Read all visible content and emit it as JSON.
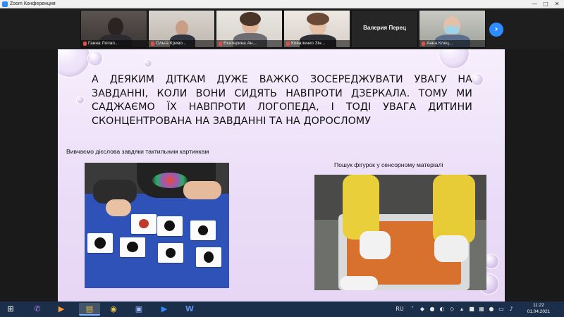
{
  "window": {
    "title": "Zoom Конференция",
    "minimize_glyph": "—",
    "maximize_glyph": "□",
    "close_glyph": "✕"
  },
  "participants": [
    {
      "name": "Ганна Лопап..."
    },
    {
      "name": "Ольга Криво..."
    },
    {
      "name": "Екатерина Ан..."
    },
    {
      "name": "Коваленко Зін..."
    },
    {
      "name": "Валерия Перец"
    },
    {
      "name": "Анна Клец..."
    }
  ],
  "next_page_glyph": "›",
  "slide": {
    "heading": "А ДЕЯКИМ ДІТКАМ ДУЖЕ ВАЖКО ЗОСЕРЕДЖУВАТИ УВАГУ НА ЗАВДАННІ, КОЛИ ВОНИ СИДЯТЬ НАВПРОТИ ДЗЕРКАЛА. ТОМУ МИ САДЖАЄМО ЇХ НАВПРОТИ ЛОГОПЕДА, І ТОДІ УВАГА ДИТИНИ СКОНЦЕНТРОВАНА НА ЗАВДАННІ ТА НА ДОРОСЛОМУ",
    "caption_left": "Вивчаємо дієслова завдяки тактильним картинкам",
    "caption_right": "Пошук фігурок у сенсорному матеріалі"
  },
  "taskbar": {
    "apps": [
      {
        "icon": "windows-start-icon",
        "glyph": "⊞"
      },
      {
        "icon": "viber-icon",
        "glyph": "✆"
      },
      {
        "icon": "media-player-icon",
        "glyph": "▶"
      },
      {
        "icon": "file-explorer-icon",
        "glyph": "▤"
      },
      {
        "icon": "chrome-icon",
        "glyph": "◉"
      },
      {
        "icon": "save-icon",
        "glyph": "▣"
      },
      {
        "icon": "zoom-icon",
        "glyph": "▶"
      },
      {
        "icon": "word-icon",
        "glyph": "W"
      }
    ],
    "tray": {
      "lang": "RU",
      "time": "11:22",
      "date": "01.04.2021"
    }
  }
}
